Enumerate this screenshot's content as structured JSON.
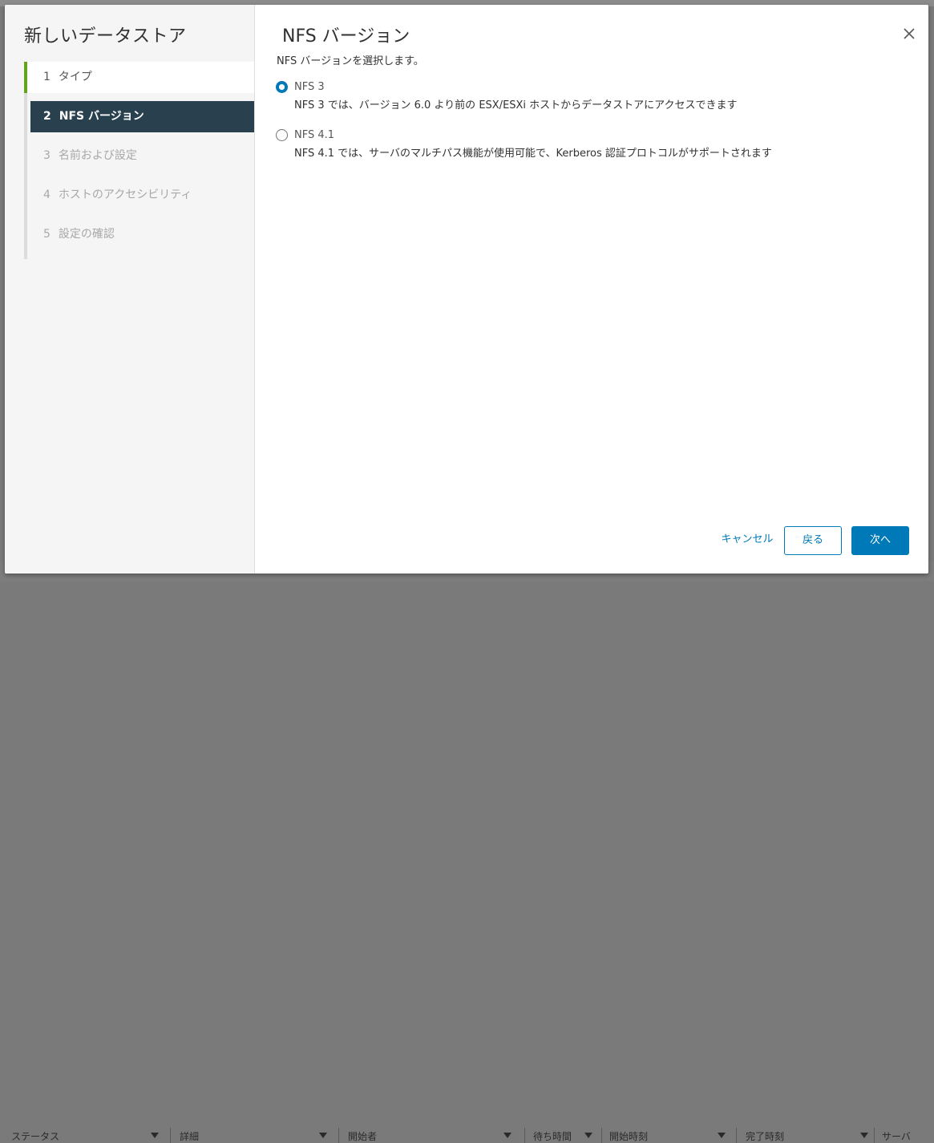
{
  "background_table": {
    "columns": [
      "ステータス",
      "詳細",
      "開始者",
      "待ち時間",
      "開始時刻",
      "完了時刻",
      "サーバ"
    ]
  },
  "wizard": {
    "title": "新しいデータストア",
    "steps": [
      {
        "number": "1",
        "label": "タイプ",
        "state": "done"
      },
      {
        "number": "2",
        "label": "NFS バージョン",
        "state": "active"
      },
      {
        "number": "3",
        "label": "名前および設定",
        "state": "pending"
      },
      {
        "number": "4",
        "label": "ホストのアクセシビリティ",
        "state": "pending"
      },
      {
        "number": "5",
        "label": "設定の確認",
        "state": "pending"
      }
    ]
  },
  "page": {
    "title": "NFS バージョン",
    "subtitle": "NFS バージョンを選択します。",
    "close_icon": "close-icon",
    "options": [
      {
        "label": "NFS 3",
        "description": "NFS 3 では、バージョン 6.0 より前の ESX/ESXi ホストからデータストアにアクセスできます",
        "checked": true
      },
      {
        "label": "NFS 4.1",
        "description": "NFS 4.1 では、サーバのマルチパス機能が使用可能で、Kerberos 認証プロトコルがサポートされます",
        "checked": false
      }
    ]
  },
  "footer": {
    "cancel_label": "キャンセル",
    "back_label": "戻る",
    "next_label": "次へ"
  },
  "colors": {
    "accent": "#0079b8",
    "active_step_bg": "#29414e",
    "done_step_marker": "#62a420"
  }
}
